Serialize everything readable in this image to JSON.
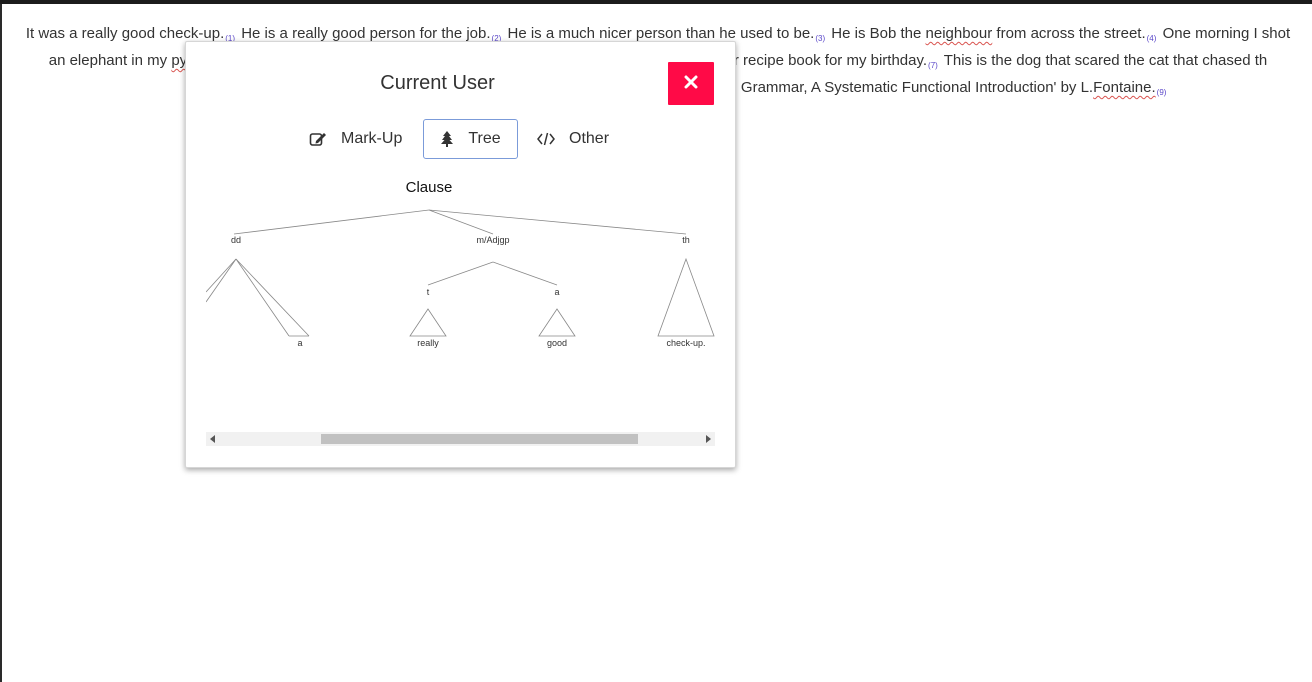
{
  "passage": {
    "sentences": [
      {
        "text": "It was a really good check-up.",
        "num": "(1)"
      },
      {
        "text": "He is a really good person for the job.",
        "num": "(2)"
      },
      {
        "text": "He is a much nicer person than he used to be.",
        "num": "(3)"
      },
      {
        "text": "He is Bob the ",
        "extra": "neighbour",
        "after": " from across the street.",
        "num": "(4)"
      },
      {
        "text": "One morning I shot an elephant in my ",
        "extra": "pyjamas",
        "num": ""
      }
    ],
    "line2_tail": "e new Jamie Oliver recipe book for my birthday.",
    "num7": "(7)",
    "line2_end": "This is the dog that scared the cat",
    "line3_start": "that chased th",
    "line3_tail": "English Grammar, A Systematic Functional Introduction' by L.",
    "line3_name": "Fontaine.",
    "num9": "(9)"
  },
  "modal": {
    "title": "Current User",
    "close_icon": "close-icon",
    "tabs": [
      {
        "label": "Mark-Up",
        "icon": "edit-icon"
      },
      {
        "label": "Tree",
        "icon": "tree-icon",
        "active": true
      },
      {
        "label": "Other",
        "icon": "code-icon"
      }
    ]
  },
  "tree": {
    "root": "Clause",
    "children": [
      {
        "label": "dd",
        "leaves": [
          {
            "label": "a"
          }
        ]
      },
      {
        "label": "m/Adjgp",
        "children": [
          {
            "label": "t",
            "leaf": "really"
          },
          {
            "label": "a",
            "leaf": "good"
          }
        ]
      },
      {
        "label": "th",
        "leaf": "check-up."
      }
    ]
  },
  "colors": {
    "close_button": "#ff0a47",
    "tab_active_border": "#7b9bd9",
    "sentence_number": "#5b48c9"
  }
}
